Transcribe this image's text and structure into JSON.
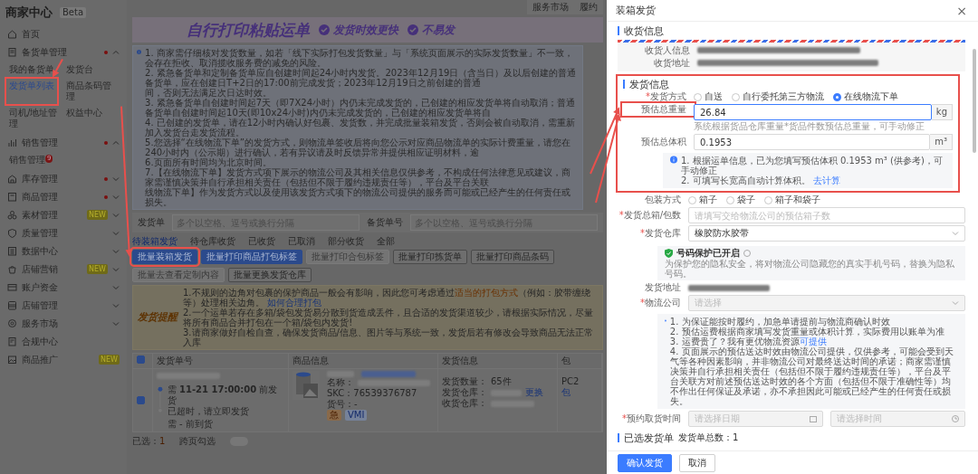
{
  "app": {
    "title": "商家中心",
    "tag": "Beta"
  },
  "top_links": [
    "服务市场",
    "履约"
  ],
  "sidebar": [
    {
      "label": "首页"
    },
    {
      "label": "备货单管理",
      "dot": true,
      "expanded": true,
      "children": [
        {
          "label": "我的备货单",
          "selected": false
        },
        {
          "label": "发货台",
          "selected": false
        },
        {
          "label": "发货单列表",
          "selected": true,
          "highlighted": true
        },
        {
          "label": "商品条码管理",
          "selected": false
        },
        {
          "label": "司机/地址管理",
          "selected": false
        },
        {
          "label": "权益中心",
          "selected": false
        }
      ]
    },
    {
      "label": "销售管理",
      "dot": true,
      "expanded": true,
      "children": [
        {
          "label": "销售管理",
          "selected": false,
          "badge": "9"
        }
      ]
    },
    {
      "label": "库存管理",
      "dot": true,
      "expanded": false
    },
    {
      "label": "商品管理",
      "dot": true,
      "expanded": false
    },
    {
      "label": "素材管理",
      "tag": "NEW",
      "expanded": false
    },
    {
      "label": "质量管理",
      "expanded": false
    },
    {
      "label": "数据中心",
      "expanded": false
    },
    {
      "label": "店铺营销",
      "tag": "NEW",
      "expanded": false
    },
    {
      "label": "账户资金",
      "expanded": false
    },
    {
      "label": "店铺管理",
      "expanded": false
    },
    {
      "label": "服务市场",
      "expanded": false
    },
    {
      "label": "合规中心"
    },
    {
      "label": "商品推广",
      "tag": "NEW"
    }
  ],
  "banner": {
    "title": "自行打印粘贴运单",
    "features": [
      "发货时效更快",
      "不易发"
    ]
  },
  "notice": [
    "1. 商家需仔细核对发货数量，如若「线下实际打包发货数量」与「系统页面展示的实际发货数量」不一致，会存在拒收、取消揽收服务费的减免的风险。",
    "2. 紧急备货单和定制备货单应自创建时间起24小时内发货。2023年12月19日（含当日）及以后创建的普通备货单，应在创建日T+2日的17:00前完成发货；2023年12月19日之前创建的普通",
    "间，否则无法满足次日达时效。",
    "3. 紧急备货单自创建时间起7天（即7X24小时）内仍未完成发货的，已创建的相应发货单将自动取消；普通备货单自创建时间起10天(即10x24小时)内仍未完成发货的，已创建的相应发货单将自",
    "4. 已创建的发货单，请在12小时内确认好包裹、发货数，并完成批量装箱发货，否则会被自动取消，需重新加入发货台走发货流程。",
    "5.您选择“在线物流下单”的发货方式，则物流单签收后将向您公示对应商品物流单的实际计费重量，请您在240小时内（公示期）进行确认，若有异议请及时反馈异常并提供相应证明材料，逾",
    "6.页面所有时间均为北京时间。",
    "7.【在线物流下单】发货方式项下展示的物流公司及其相关信息仅供参考，不构成任何法律意见或建议，商家需谨慎决策并自行承担相关责任（包括但不限于履约违规责任等），平台及平台关联",
    "线物流下单】作为发货方式以及使用该发货方式项下的物流公司提供的服务而可能或已经产生的任何责任或损失。"
  ],
  "search": [
    {
      "label": "发货单",
      "placeholder": "多个以空格、逗号或换行分隔"
    },
    {
      "label": "备货单号",
      "placeholder": "多个以空格、逗号或换行分隔"
    }
  ],
  "status_tabs": [
    {
      "label": "待装箱发货",
      "selected": true
    },
    {
      "label": "待仓库收货",
      "selected": false
    },
    {
      "label": "已收货",
      "selected": false
    },
    {
      "label": "已取消",
      "selected": false
    },
    {
      "label": "部分收货",
      "selected": false
    },
    {
      "label": "全部",
      "selected": false
    }
  ],
  "actions": [
    {
      "label": "批量装箱发货",
      "kind": "primary",
      "highlighted": true
    },
    {
      "label": "批量打印商品打包标签",
      "kind": "primary"
    },
    {
      "label": "批量打印合包标签",
      "kind": "disabled"
    },
    {
      "label": "批量打印拣货单",
      "kind": "default"
    },
    {
      "label": "批量打印商品条码",
      "kind": "default"
    },
    {
      "label": "批量去查看定制内容",
      "kind": "disabled"
    },
    {
      "label": "批量更换发货仓库",
      "kind": "default"
    }
  ],
  "tips": {
    "title": "发货提醒",
    "lines": [
      [
        {
          "kind": "text",
          "text": "1.不规则的边角对包裹的保护商品一般会有影响，因此您可考虑通过"
        },
        {
          "kind": "accent",
          "text": "适当的打包方式"
        },
        {
          "kind": "text",
          "text": "（例如：胶带缠绕等）处理相关边角。 "
        },
        {
          "kind": "link",
          "text": "如何合理打包"
        }
      ],
      [
        {
          "kind": "text",
          "text": "2.一个运单若存在多箱/袋包发货易分散到货造成丢件，且合适的发货渠道较少，请根据实际情况，尽量将所有商品合并打包在一个箱/袋包内发货!"
        }
      ],
      [
        {
          "kind": "text",
          "text": "3.请商家做好自检自查，确保发货商品/信息、图片等与系统一致，发货后若有修改会导致商品无法正常入库"
        }
      ]
    ]
  },
  "table": {
    "header_checked": true,
    "columns": [
      "发货单号",
      "商品信息",
      "发货信息",
      "包"
    ],
    "rows": [
      {
        "checked": true,
        "deadline": "需 **11-21 17:00:00** 前发货",
        "overdue": "已超时，请立即发货",
        "arrival": "需 - 前到货",
        "name_label": "名称：",
        "skc": "SKC：76539376787",
        "item_no": "货号：-",
        "tags": [
          {
            "text": "急",
            "kind": "warn"
          },
          {
            "text": "VMI",
            "kind": "info"
          }
        ],
        "qty_label": "发货数量：",
        "qty": "65件",
        "from_label": "发货仓库：",
        "change": "更换",
        "to_label": "收货仓库：",
        "col5": "PC2",
        "col5_link": "包"
      }
    ]
  },
  "footer": {
    "selected_label": "已选：",
    "selected_count": "1",
    "cross_page_label": "跨页勾选",
    "cross_page": false
  },
  "drawer": {
    "title": "装箱发货",
    "close": "×",
    "required_mark": "*",
    "receiver": {
      "title": "收货信息",
      "rows": [
        "收货人信息",
        "收货地址"
      ]
    },
    "shipping": {
      "title": "发货信息",
      "highlighted": true,
      "fields": [
        {
          "kind": "radio",
          "label": "发货方式",
          "required": true,
          "options": [
            {
              "label": "自送",
              "selected": false
            },
            {
              "label": "自行委托第三方物流",
              "selected": false
            },
            {
              "label": "在线物流下单",
              "selected": true
            }
          ]
        },
        {
          "kind": "input",
          "label": "预估总重量",
          "value": "26.84",
          "unit": "kg",
          "focused": true,
          "highlighted": true,
          "hint": "系统根据货品仓库重量*货品件数预估总重量，可手动修正"
        },
        {
          "kind": "input",
          "label": "预估总体积",
          "value": "0.1953",
          "unit": "m³",
          "focused": false
        },
        {
          "kind": "note",
          "lines": [
            [
              {
                "kind": "text",
                "text": "1. 根据运单信息，已为您填写预估体积 0.1953 m³ (供参考)，可手动修正"
              }
            ],
            [
              {
                "kind": "text",
                "text": "2. 可填写长宽高自动计算体积。 "
              },
              {
                "kind": "link",
                "text": "去计算"
              }
            ]
          ]
        }
      ]
    },
    "fields": [
      {
        "kind": "radio",
        "label": "包装方式",
        "required": false,
        "options": [
          {
            "label": "箱子",
            "selected": false
          },
          {
            "label": "袋子",
            "selected": false
          },
          {
            "label": "箱子和袋子",
            "selected": false
          }
        ]
      },
      {
        "kind": "input",
        "label": "发货总箱/包数",
        "required": true,
        "placeholder": "请填写交给物流公司的预估箱子数"
      },
      {
        "kind": "select",
        "label": "发货仓库",
        "required": true,
        "value": "橡胶防水胶带"
      },
      {
        "kind": "protect",
        "title": "号码保护已开启",
        "text": "为保护您的隐私安全，将对物流公司隐藏您的真实手机号码，替换为隐私号码。"
      },
      {
        "kind": "static",
        "label": "发货地址"
      },
      {
        "kind": "select",
        "label": "物流公司",
        "required": true,
        "placeholder": "请选择"
      },
      {
        "kind": "note",
        "lines": [
          [
            {
              "kind": "text",
              "text": "1. 为保证能按时履约，加急单请提前与物流商确认时效"
            }
          ],
          [
            {
              "kind": "text",
              "text": "2. 预估运费根据商家填写发货重量或体积计算，实际费用以账单为准"
            }
          ],
          [
            {
              "kind": "text",
              "text": "3. 运费贵了？我有更优物流资源"
            },
            {
              "kind": "link",
              "text": "可提供"
            }
          ],
          [
            {
              "kind": "text",
              "text": "4. 页面展示的预估送达时效由物流公司提供，仅供参考，可能会受到天气等各种因素影响，并非物流公司对最终送达时间的承诺；商家需谨慎决策并自行承担相关责任（包括但不限于履约违规责任等），平台及平台关联方对前述预估送达时效的各个方面（包括但不限于准确性等）均不作出任何保证及承诺，亦不承担因此可能或已经产生的任何责任或损失。"
            }
          ]
        ]
      },
      {
        "kind": "datetime",
        "label": "预约取货时间",
        "required": true,
        "placeholders": [
          "请选择日期",
          "请选择时间"
        ]
      }
    ],
    "selected": {
      "title": "已选发货单",
      "count": "发货单总数：1"
    },
    "buttons": [
      {
        "label": "确认发货",
        "kind": "primary"
      },
      {
        "label": "取消",
        "kind": "default"
      }
    ]
  }
}
